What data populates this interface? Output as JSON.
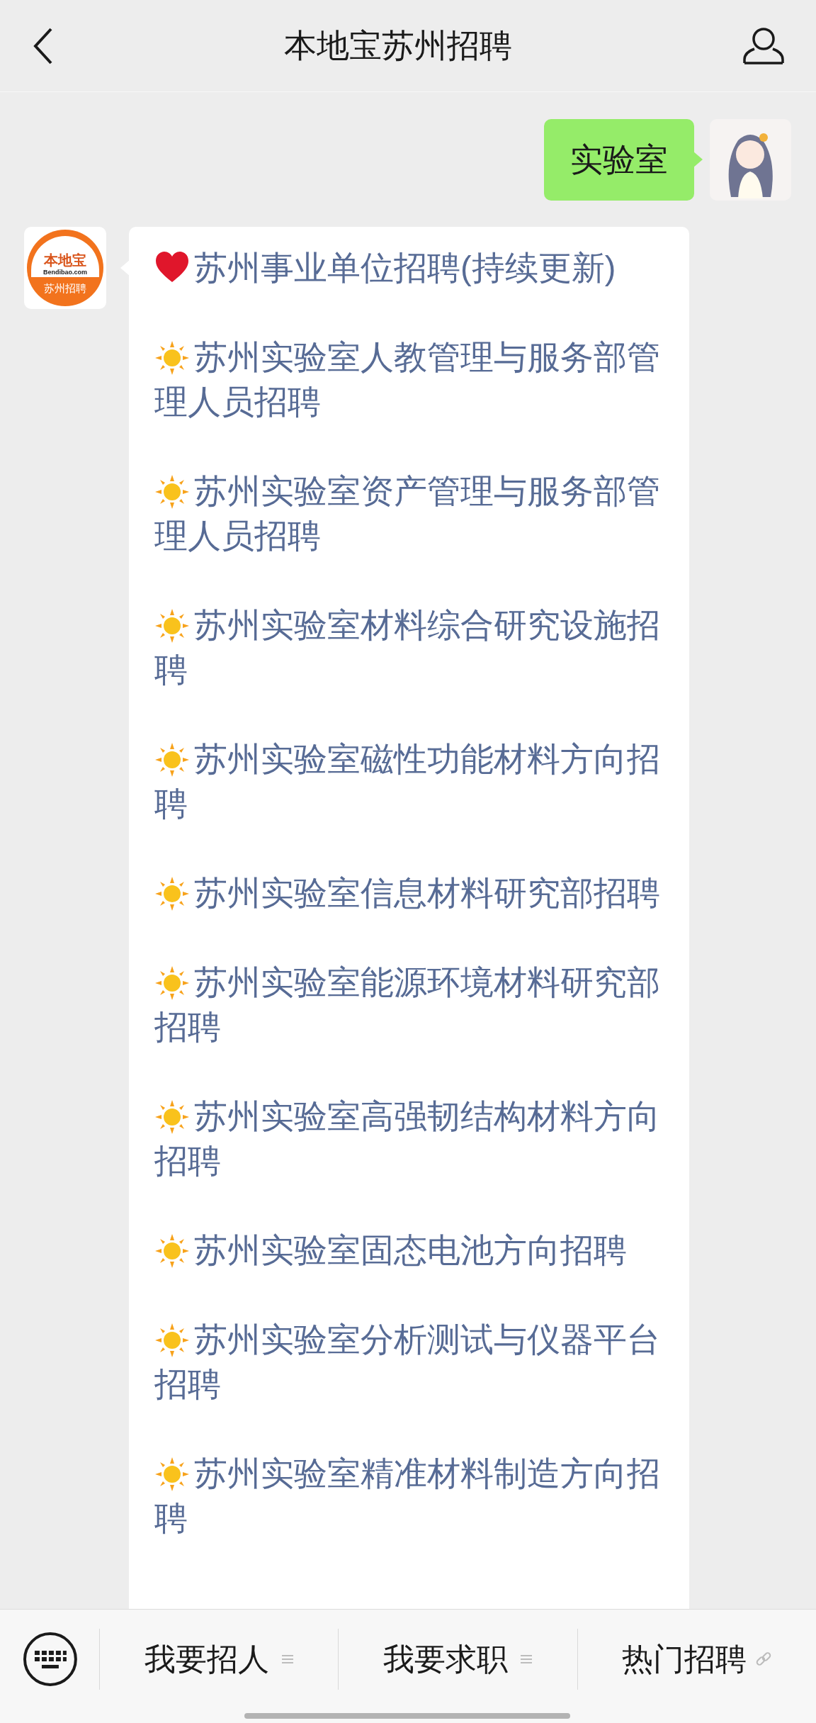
{
  "header": {
    "title": "本地宝苏州招聘"
  },
  "messages": [
    {
      "kind": "sent",
      "text": "实验室"
    },
    {
      "kind": "links",
      "logo": {
        "name": "本地宝",
        "site": "Bendibao.com",
        "caption": "苏州招聘"
      },
      "items": [
        {
          "kind": "heart",
          "text": "苏州事业单位招聘(持续更新)"
        },
        {
          "kind": "sun",
          "text": "苏州实验室人教管理与服务部管理人员招聘"
        },
        {
          "kind": "sun",
          "text": "苏州实验室资产管理与服务部管理人员招聘"
        },
        {
          "kind": "sun",
          "text": "苏州实验室材料综合研究设施招聘"
        },
        {
          "kind": "sun",
          "text": "苏州实验室磁性功能材料方向招聘"
        },
        {
          "kind": "sun",
          "text": "苏州实验室信息材料研究部招聘"
        },
        {
          "kind": "sun",
          "text": "苏州实验室能源环境材料研究部招聘"
        },
        {
          "kind": "sun",
          "text": "苏州实验室高强韧结构材料方向招聘"
        },
        {
          "kind": "sun",
          "text": "苏州实验室固态电池方向招聘"
        },
        {
          "kind": "sun",
          "text": "苏州实验室分析测试与仪器平台招聘"
        },
        {
          "kind": "sun",
          "text": "苏州实验室精准材料制造方向招聘"
        }
      ]
    }
  ],
  "menu": [
    {
      "label": "我要招人",
      "kind": "submenu"
    },
    {
      "label": "我要求职",
      "kind": "submenu"
    },
    {
      "label": "热门招聘",
      "kind": "link"
    }
  ]
}
